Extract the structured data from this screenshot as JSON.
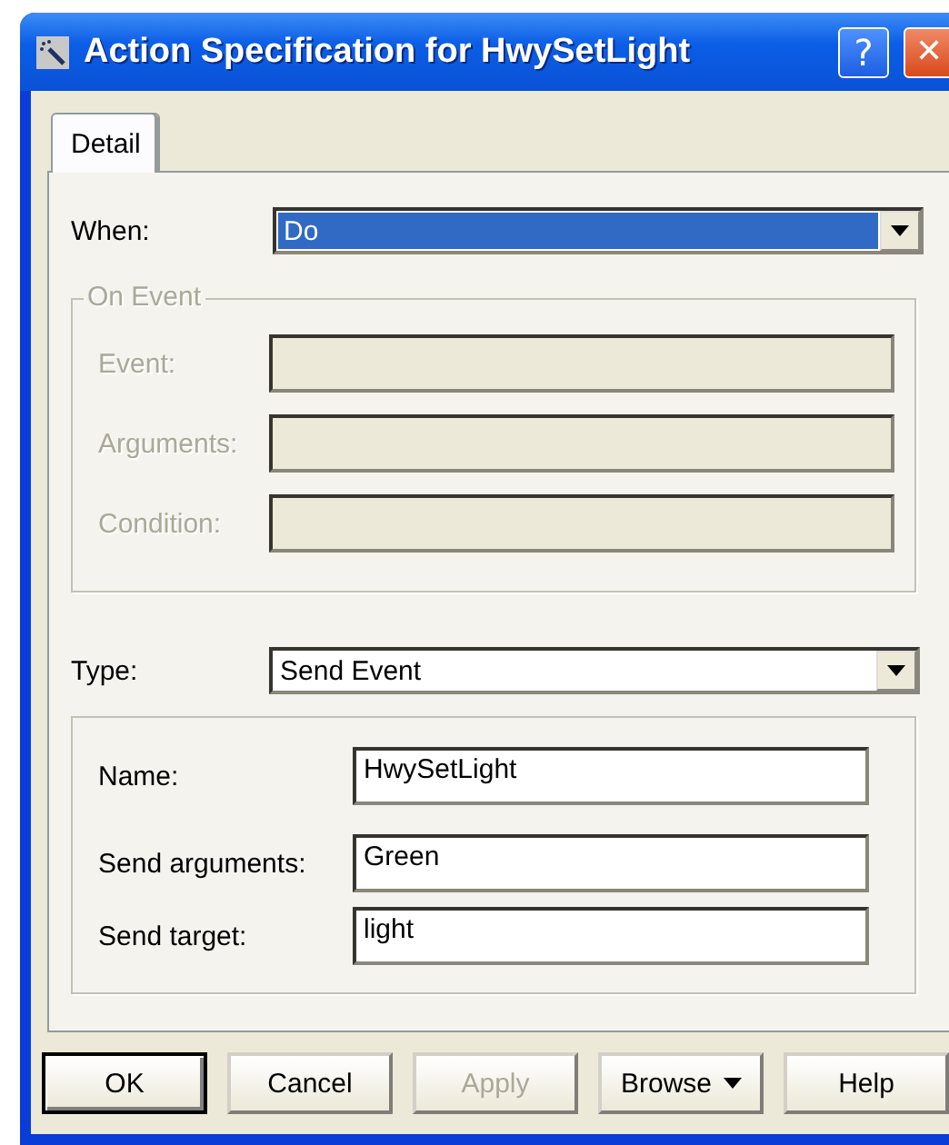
{
  "window": {
    "title": "Action Specification for HwySetLight",
    "title_buttons": [
      {
        "kind": "help",
        "glyph": "?"
      },
      {
        "kind": "close",
        "glyph": "✕"
      }
    ]
  },
  "tabs": [
    {
      "label": "Detail",
      "selected": true
    }
  ],
  "when": {
    "label": "When:",
    "value": "Do",
    "focused": true
  },
  "on_event": {
    "title": "On Event",
    "disabled": true,
    "fields": [
      {
        "label": "Event:"
      },
      {
        "label": "Arguments:"
      },
      {
        "label": "Condition:"
      }
    ]
  },
  "type": {
    "label": "Type:",
    "value": "Send Event",
    "focused": false
  },
  "send_event": {
    "fields": [
      {
        "label": "Name:",
        "value": "HwySetLight"
      },
      {
        "label": "Send arguments:",
        "value": "Green"
      },
      {
        "label": "Send target:",
        "value": "light"
      }
    ]
  },
  "buttons": [
    {
      "label": "OK",
      "kind": "default",
      "disabled": false
    },
    {
      "label": "Cancel",
      "kind": "plain",
      "disabled": false
    },
    {
      "label": "Apply",
      "kind": "plain",
      "disabled": true
    },
    {
      "label": "Browse",
      "kind": "menu",
      "disabled": false
    },
    {
      "label": "Help",
      "kind": "plain",
      "disabled": false
    }
  ]
}
